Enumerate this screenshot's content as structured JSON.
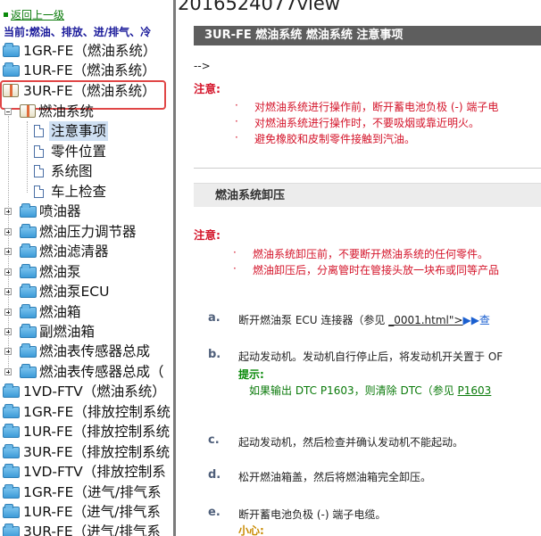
{
  "tree": {
    "back_link": "返回上一级",
    "current_path": "当前:燃油、排放、进/排气、冷",
    "items": [
      {
        "label": "1GR-FE（燃油系统）"
      },
      {
        "label": "1UR-FE（燃油系统）"
      },
      {
        "label": "3UR-FE（燃油系统）"
      },
      {
        "label": "燃油系统"
      },
      {
        "label": "注意事项"
      },
      {
        "label": "零件位置"
      },
      {
        "label": "系统图"
      },
      {
        "label": "车上检查"
      },
      {
        "label": "喷油器"
      },
      {
        "label": "燃油压力调节器"
      },
      {
        "label": "燃油滤清器"
      },
      {
        "label": "燃油泵"
      },
      {
        "label": "燃油泵ECU"
      },
      {
        "label": "燃油箱"
      },
      {
        "label": "副燃油箱"
      },
      {
        "label": "燃油表传感器总成"
      },
      {
        "label": "燃油表传感器总成（"
      },
      {
        "label": "1VD-FTV（燃油系统）"
      },
      {
        "label": "1GR-FE（排放控制系统"
      },
      {
        "label": "1UR-FE（排放控制系统"
      },
      {
        "label": "3UR-FE（排放控制系统"
      },
      {
        "label": "1VD-FTV（排放控制系"
      },
      {
        "label": "1GR-FE（进气/排气系"
      },
      {
        "label": "1UR-FE（进气/排气系"
      },
      {
        "label": "3UR-FE（进气/排气系"
      }
    ]
  },
  "content": {
    "title": "2016524077view",
    "header": "3UR-FE 燃油系统  燃油系统  注意事项",
    "arrow_text": "-->",
    "note_label": "注意:",
    "notes": [
      "对燃油系统进行操作前，断开蓄电池负极 (-) 端子电",
      "对燃油系统进行操作时，不要吸烟或靠近明火。",
      "避免橡胶和皮制零件接触到汽油。"
    ],
    "section_title": "燃油系统卸压",
    "note2_label": "注意:",
    "notes2": [
      "燃油系统卸压前，不要断开燃油系统的任何零件。",
      "燃油卸压后，分离管时在管接头放一块布或同等产品"
    ],
    "steps": [
      {
        "letter": "a.",
        "pre": "断开燃油泵 ECU 连接器（参见 ",
        "link": "_0001.html\">",
        "arrow": "▶▶查"
      },
      {
        "letter": "b.",
        "text": "起动发动机。发动机自行停止后，将发动机开关置于 OF",
        "hint_label": "提示:",
        "hint_pre": "如果输出 DTC P1603，则清除 DTC（参见 ",
        "hint_link": "P1603"
      },
      {
        "letter": "c.",
        "text": "起动发动机，然后检查并确认发动机不能起动。"
      },
      {
        "letter": "d.",
        "text": "松开燃油箱盖，然后将燃油箱完全卸压。"
      },
      {
        "letter": "e.",
        "text": "断开蓄电池负极 (-) 端子电缆。",
        "caution_label": "小心:"
      }
    ]
  },
  "colors": {
    "note_red": "#d4142a",
    "hint_green": "#0a8a0a",
    "header_bg": "#5e5e5e",
    "highlight_box": "#e04646"
  }
}
